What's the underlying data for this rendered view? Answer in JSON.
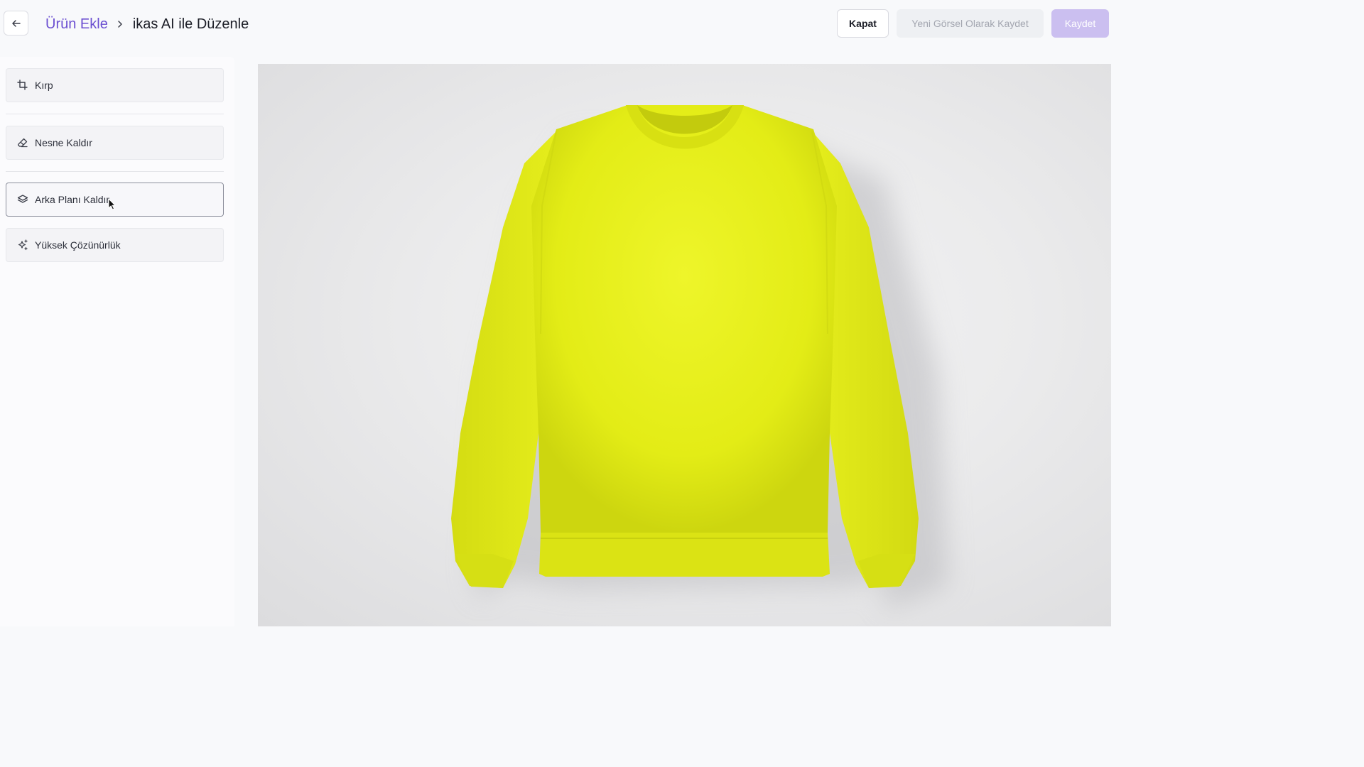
{
  "header": {
    "breadcrumb": {
      "parent": "Ürün Ekle",
      "current": "ikas AI ile Düzenle"
    },
    "buttons": {
      "close": "Kapat",
      "save_as_new": "Yeni Görsel Olarak Kaydet",
      "save": "Kaydet"
    },
    "icons": {
      "back": "arrow-left-icon",
      "separator": "chevron-right-icon"
    }
  },
  "sidebar": {
    "tools": [
      {
        "label": "Kırp",
        "icon": "crop-icon",
        "active": false
      },
      {
        "label": "Nesne Kaldır",
        "icon": "eraser-icon",
        "active": false
      },
      {
        "label": "Arka Planı Kaldır",
        "icon": "layers-icon",
        "active": true
      },
      {
        "label": "Yüksek Çözünürlük",
        "icon": "sparkles-icon",
        "active": false
      }
    ]
  },
  "canvas": {
    "subject": "yellow crewneck sweatshirt",
    "colors": {
      "garment": "#e6ee1c",
      "garment_shadow": "#c9d30f",
      "background": "#ececed"
    }
  },
  "colors": {
    "accent": "#6b4fd1",
    "primary_disabled": "#cbbff0",
    "active_border": "#8c8f9c"
  }
}
